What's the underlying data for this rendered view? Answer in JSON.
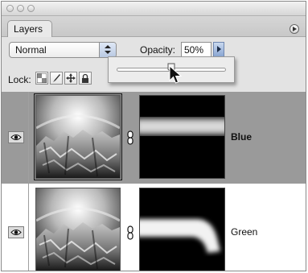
{
  "panel": {
    "tab_label": "Layers"
  },
  "blend_mode": {
    "value": "Normal"
  },
  "opacity": {
    "label": "Opacity:",
    "value": "50%",
    "level": 0.5
  },
  "lock": {
    "label": "Lock:"
  },
  "layers": [
    {
      "name": "Blue",
      "selected": true,
      "row_color": "#9a9a9a"
    },
    {
      "name": "Green",
      "selected": false,
      "row_color": "#ffffff"
    }
  ],
  "icons": [
    "eye-icon",
    "chain-link-icon",
    "panel-menu-icon",
    "brush-icon",
    "move-icon",
    "lock-icon"
  ]
}
